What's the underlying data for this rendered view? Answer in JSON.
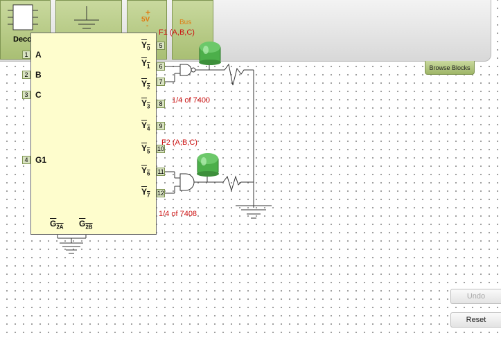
{
  "palette": {
    "decoder_label": "Decod",
    "supply_plus": "+",
    "supply_voltage": "5V",
    "supply_minus": "-",
    "bus_label": "Bus"
  },
  "browse_blocks": "Browse Blocks",
  "decoder": {
    "inputs": [
      {
        "pin": "1",
        "name": "A"
      },
      {
        "pin": "2",
        "name": "B"
      },
      {
        "pin": "3",
        "name": "C"
      },
      {
        "pin": "4",
        "name": "G1"
      }
    ],
    "outputs": [
      {
        "pin": "5",
        "name": "Y",
        "sub": "0"
      },
      {
        "pin": "6",
        "name": "Y",
        "sub": "1"
      },
      {
        "pin": "7",
        "name": "Y",
        "sub": "2"
      },
      {
        "pin": "8",
        "name": "Y",
        "sub": "3"
      },
      {
        "pin": "9",
        "name": "Y",
        "sub": "4"
      },
      {
        "pin": "10",
        "name": "Y",
        "sub": "5"
      },
      {
        "pin": "11",
        "name": "Y",
        "sub": "6"
      },
      {
        "pin": "12",
        "name": "Y",
        "sub": "7"
      }
    ],
    "enable_2a": {
      "name": "G",
      "sub": "2A"
    },
    "enable_2b": {
      "name": "G",
      "sub": "2B"
    }
  },
  "annotations": {
    "f1": "F1 (A,B,C)",
    "nand_part": "1/4 of 7400",
    "f2": "F2 (A,B,C)",
    "and_part": "1/4 of 7408"
  },
  "buttons": {
    "undo": "Undo",
    "reset": "Reset"
  },
  "colors": {
    "led": "#4caf4a",
    "annotation": "#cc1111",
    "accent": "#a9bf74"
  }
}
